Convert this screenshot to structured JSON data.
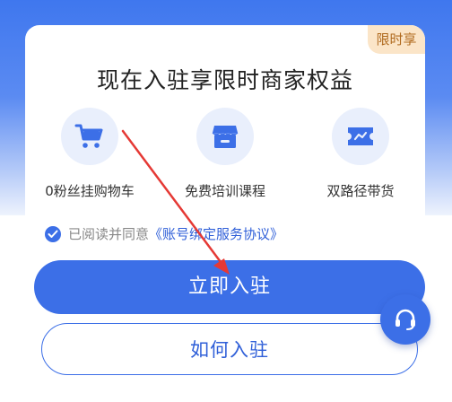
{
  "badge": "限时享",
  "title": "现在入驻享限时商家权益",
  "benefits": [
    {
      "icon": "shopping-cart-icon",
      "label": "0粉丝挂购物车"
    },
    {
      "icon": "store-icon",
      "label": "免费培训课程"
    },
    {
      "icon": "ticket-icon",
      "label": "双路径带货"
    }
  ],
  "agreement": {
    "checked": true,
    "prefix": "已阅读并同意",
    "link": "《账号绑定服务协议》"
  },
  "buttons": {
    "primary": "立即入驻",
    "secondary": "如何入驻"
  },
  "colors": {
    "accent": "#3c6fe7",
    "annotation_arrow": "#e53935",
    "badge_bg": "#fbe5c8"
  }
}
